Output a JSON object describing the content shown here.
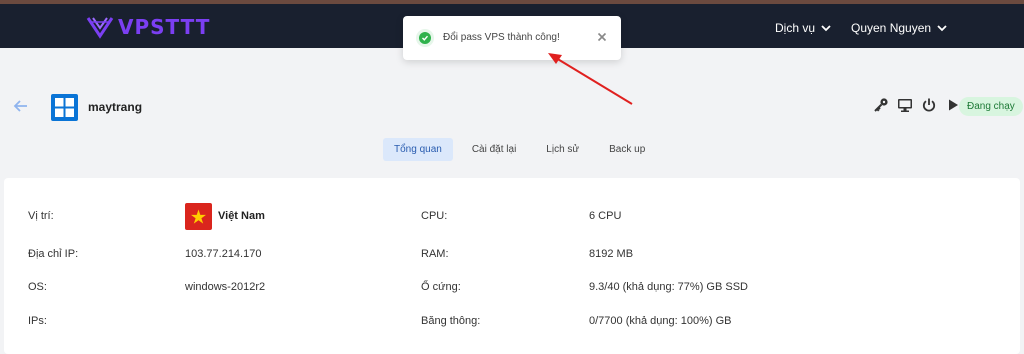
{
  "header": {
    "brand": "VPSTTT",
    "nav_services": "Dịch vụ",
    "nav_user": "Quyen Nguyen"
  },
  "toast": {
    "message": "Đổi pass VPS thành công!"
  },
  "vm": {
    "name": "maytrang",
    "status": "Đang chạy"
  },
  "tabs": [
    {
      "label": "Tổng quan",
      "active": true
    },
    {
      "label": "Cài đặt lại",
      "active": false
    },
    {
      "label": "Lịch sử",
      "active": false
    },
    {
      "label": "Back up",
      "active": false
    }
  ],
  "details": {
    "location_label": "Vị trí:",
    "location_value": "Việt Nam",
    "ip_label": "Địa chỉ IP:",
    "ip_value": "103.77.214.170",
    "os_label": "OS:",
    "os_value": "windows-2012r2",
    "ips_label": "IPs:",
    "cpu_label": "CPU:",
    "cpu_value": "6 CPU",
    "ram_label": "RAM:",
    "ram_value": "8192 MB",
    "disk_label": "Ổ cứng:",
    "disk_value": "9.3/40 (khả dụng: 77%) GB SSD",
    "bw_label": "Băng thông:",
    "bw_value": "0/7700 (khả dụng: 100%) GB"
  },
  "colors": {
    "header_bg": "#19202f",
    "brand": "#7b3ff2",
    "status_bg": "#d8f5df",
    "arrow": "#e0201f"
  },
  "icons": [
    "back-arrow-icon",
    "windows-icon",
    "key-icon",
    "monitor-icon",
    "power-icon",
    "play-icon",
    "check-icon",
    "close-icon",
    "chevron-down-icon",
    "vietnam-flag-icon"
  ]
}
